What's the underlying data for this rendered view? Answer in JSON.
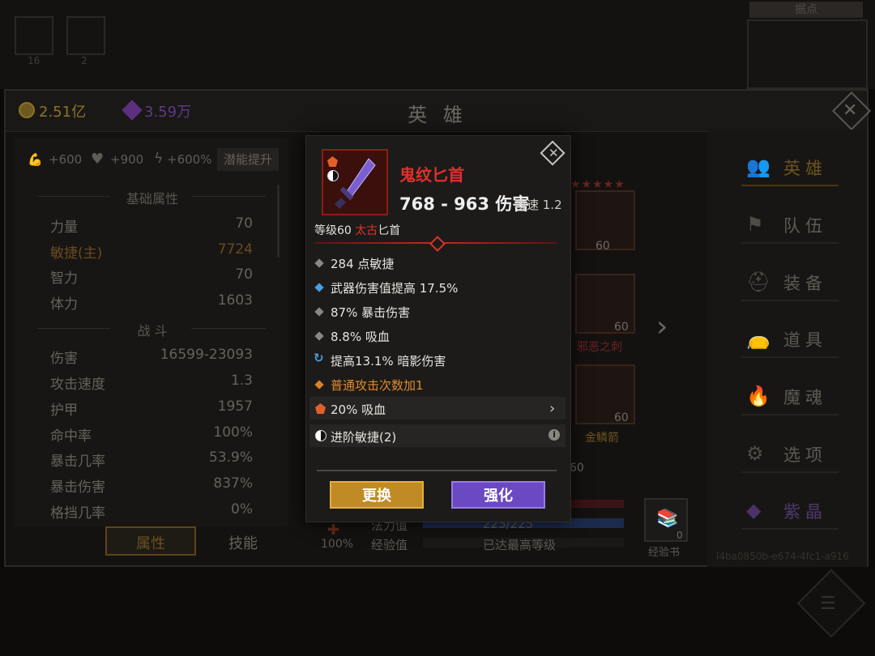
{
  "background": {
    "slot_counts": [
      "16",
      "2"
    ],
    "map_label": "据点"
  },
  "header": {
    "gold": "2.51亿",
    "gems": "3.59万",
    "title": "英 雄",
    "colors": {
      "gold": "#8b7326",
      "gem": "#5d2f80"
    }
  },
  "left_panel": {
    "bonuses": [
      {
        "icon": "arm-icon",
        "value": "+600"
      },
      {
        "icon": "heart-icon",
        "value": "+900"
      },
      {
        "icon": "lightning-icon",
        "value": "+600%"
      }
    ],
    "potential_button": "潜能提升",
    "basic_section": "基础属性",
    "basic_stats": [
      {
        "label": "力量",
        "value": "70"
      },
      {
        "label": "敏捷(主)",
        "value": "7724",
        "main": true
      },
      {
        "label": "智力",
        "value": "70"
      },
      {
        "label": "体力",
        "value": "1603"
      }
    ],
    "combat_section": "战 斗",
    "combat_stats": [
      {
        "label": "伤害",
        "value": "16599-23093"
      },
      {
        "label": "攻击速度",
        "value": "1.3"
      },
      {
        "label": "护甲",
        "value": "1957"
      },
      {
        "label": "命中率",
        "value": "100%"
      },
      {
        "label": "暴击几率",
        "value": "53.9%"
      },
      {
        "label": "暴击伤害",
        "value": "837%"
      },
      {
        "label": "格挡几率",
        "value": "0%"
      }
    ],
    "tabs": [
      "属性",
      "技能"
    ]
  },
  "middle": {
    "stars": "★★★★★",
    "slot_levels": [
      "60",
      "60",
      "60"
    ],
    "item_names": [
      "邪恶之刺",
      "金鳞箭"
    ],
    "partial_number": "60",
    "mana_label": "法力值",
    "mana_value": "225/225",
    "exp_label": "经验值",
    "exp_value": "已达最高等级",
    "percent": "100%",
    "book_count": "0",
    "book_label": "经验书"
  },
  "nav": {
    "items": [
      {
        "icon": "hero-icon",
        "label": "英雄",
        "active": true
      },
      {
        "icon": "flag-icon",
        "label": "队伍"
      },
      {
        "icon": "helmet-icon",
        "label": "装备"
      },
      {
        "icon": "bag-icon",
        "label": "道具"
      },
      {
        "icon": "fire-icon",
        "label": "魔魂"
      },
      {
        "icon": "gear-icon",
        "label": "选项"
      },
      {
        "icon": "crystal-icon",
        "label": "紫晶"
      }
    ],
    "uuid": "l4ba0850b-e674-4fc1-a916"
  },
  "popup": {
    "item_name": "鬼纹匕首",
    "damage": "768 - 963 伤害",
    "attack_speed": "攻速 1.2",
    "level_prefix": "等级60",
    "level_tier": "太古",
    "level_type": "匕首",
    "affixes": [
      {
        "bullet": "grey",
        "text": "284 点敏捷"
      },
      {
        "bullet": "blue",
        "text": "武器伤害值提高 17.5%"
      },
      {
        "bullet": "grey",
        "text": "87% 暴击伤害"
      },
      {
        "bullet": "grey",
        "text": "8.8% 吸血"
      },
      {
        "bullet": "cycle",
        "text": "提高13.1% 暗影伤害"
      },
      {
        "bullet": "orange",
        "text": "普通攻击次数加1"
      }
    ],
    "gem_row": "20% 吸血",
    "set_row": "进阶敏捷(2)",
    "buttons": {
      "replace": "更换",
      "enhance": "强化"
    },
    "colors": {
      "name": "#e0312a",
      "frame": "#8b1f14",
      "replace_btn": "#c08a24",
      "enhance_btn": "#6a49c2"
    }
  }
}
